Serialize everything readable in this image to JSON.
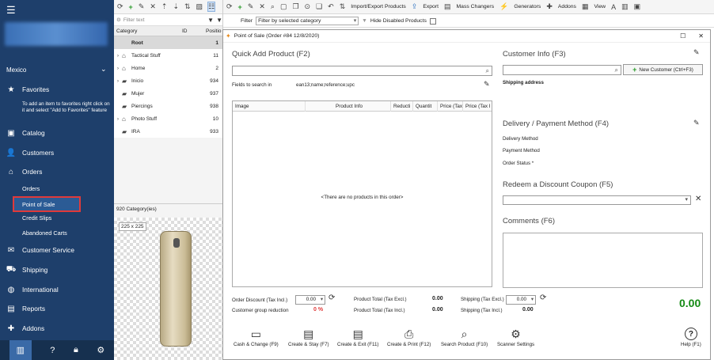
{
  "nav": {
    "store": "Mexico",
    "favorites": "Favorites",
    "favorites_note": "To add an item to favorites right click on it and select \"Add to Favorites\" feature",
    "catalog": "Catalog",
    "customers": "Customers",
    "orders": "Orders",
    "orders_sub": [
      "Orders",
      "Point of Sale",
      "Credit Slips",
      "Abandoned Carts"
    ],
    "customer_service": "Customer Service",
    "shipping": "Shipping",
    "international": "International",
    "reports": "Reports",
    "addons": "Addons"
  },
  "categories": {
    "filter_placeholder": "Filter text",
    "col_category": "Category",
    "col_id": "ID",
    "col_position": "Positio",
    "rows": [
      {
        "name": "Root",
        "id": "1",
        "expand": "",
        "icon": "root"
      },
      {
        "name": "Tactical Stuff",
        "id": "11",
        "expand": ">",
        "icon": "home"
      },
      {
        "name": "Home",
        "id": "2",
        "expand": ">",
        "icon": "home"
      },
      {
        "name": "Inicio",
        "id": "934",
        "expand": ">",
        "icon": "folder"
      },
      {
        "name": "Mujer",
        "id": "937",
        "expand": "",
        "icon": "folder"
      },
      {
        "name": "Piercings",
        "id": "938",
        "expand": "",
        "icon": "folder"
      },
      {
        "name": "Photo Stuff",
        "id": "10",
        "expand": ">",
        "icon": "home"
      },
      {
        "name": "IRA",
        "id": "933",
        "expand": "",
        "icon": "folder"
      }
    ],
    "count": "920 Category(ies)",
    "image_size": "225 x 225"
  },
  "toolbar": {
    "import_export": "Import/Export Products",
    "export": "Export",
    "mass_changers": "Mass Changers",
    "generators": "Generators",
    "addons": "Addons",
    "view": "View"
  },
  "filterbar": {
    "filter_label": "Filter",
    "filter_value": "Filter by selected category",
    "hide_disabled": "Hide Disabled Products"
  },
  "pos": {
    "title": "Point of Sale (Order #84 12/8/2020)",
    "quick_add": "Quick Add Product (F2)",
    "fields_label": "Fields to search in",
    "fields_value": "ean13;name;reference;upc",
    "grid_cols": [
      "Image",
      "Product Info",
      "Reducti",
      "Quantit",
      "Price (Tax",
      "Price (Tax I"
    ],
    "grid_empty": "<There are no products in this order>",
    "customer_info": "Customer Info (F3)",
    "new_customer": "New Customer (Ctrl+F3)",
    "shipping_address": "Shipping address",
    "delivery_payment": "Delivery / Payment Method (F4)",
    "delivery_method": "Delivery Method",
    "payment_method": "Payment Method",
    "order_status": "Order Status *",
    "discount_coupon": "Redeem a Discount Coupon (F5)",
    "comments": "Comments (F6)",
    "order_discount_label": "Order Discount (Tax Incl.)",
    "order_discount_value": "0.00",
    "group_reduction_label": "Customer group reduction",
    "group_reduction_value": "0 %",
    "product_total_excl_label": "Product Total (Tax Excl.)",
    "product_total_excl_value": "0.00",
    "product_total_incl_label": "Product Total (Tax Incl.)",
    "product_total_incl_value": "0.00",
    "shipping_excl_label": "Shipping (Tax Excl.)",
    "shipping_excl_value": "0.00",
    "shipping_incl_label": "Shipping (Tax Incl.)",
    "shipping_incl_value": "0.00",
    "grand_total": "0.00",
    "actions": [
      "Cash & Change (F9)",
      "Create & Stay (F7)",
      "Create & Exit (F11)",
      "Create & Print (F12)",
      "Search Product (F10)",
      "Scanner Settings"
    ],
    "help": "Help (F1)"
  },
  "colors": {
    "nav_bg": "#1e3f6b",
    "total_green": "#148a14",
    "highlight_red": "#e03a3a"
  }
}
